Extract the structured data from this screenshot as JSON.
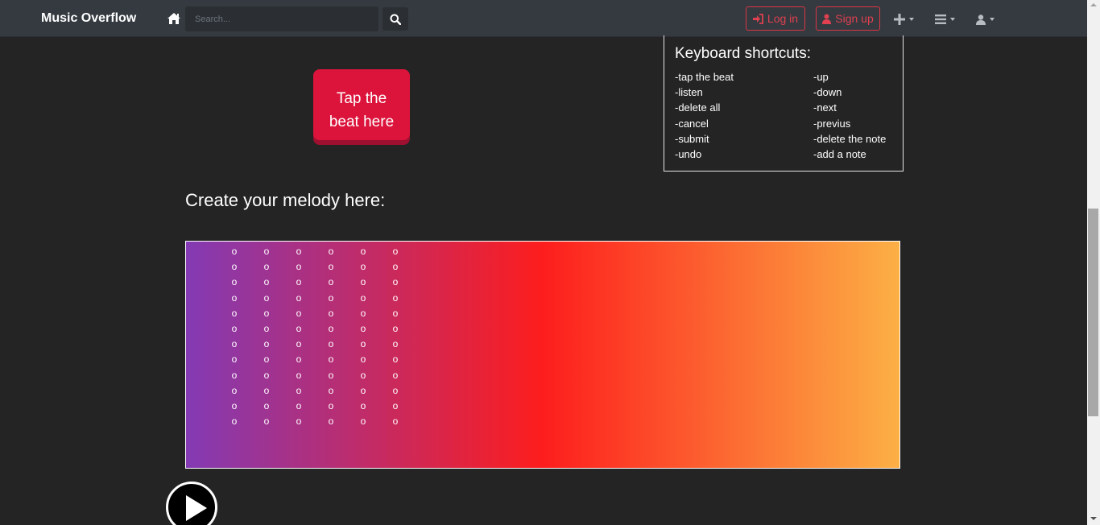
{
  "navbar": {
    "brand": "Music Overflow",
    "search_placeholder": "Search...",
    "login_label": "Log in",
    "signup_label": "Sign up"
  },
  "tap_button": {
    "line1": "Tap the",
    "line2": "beat here"
  },
  "shortcuts": {
    "title": "Keyboard shortcuts:",
    "left": [
      "-tap the beat",
      "-listen",
      "-delete all",
      "-cancel",
      "-submit",
      "-undo"
    ],
    "right": [
      "-up",
      "-down",
      "-next",
      "-previus",
      "-delete the note",
      "-add a note"
    ]
  },
  "melody": {
    "heading": "Create your melody here:",
    "note_symbol": "o",
    "columns": 6,
    "rows": 12,
    "gradient_colors": [
      "#833ab4",
      "#fd1d1d",
      "#fcb045"
    ]
  },
  "colors": {
    "navbar_bg": "#343a40",
    "page_bg": "#242424",
    "accent_red": "#dc143c",
    "auth_border": "#dc3545"
  },
  "icons": {
    "home": "home-icon",
    "search": "search-icon",
    "login": "sign-in-icon",
    "signup": "user-icon",
    "add": "plus-icon",
    "menu": "bars-icon",
    "account": "user-icon",
    "play": "play-icon"
  }
}
